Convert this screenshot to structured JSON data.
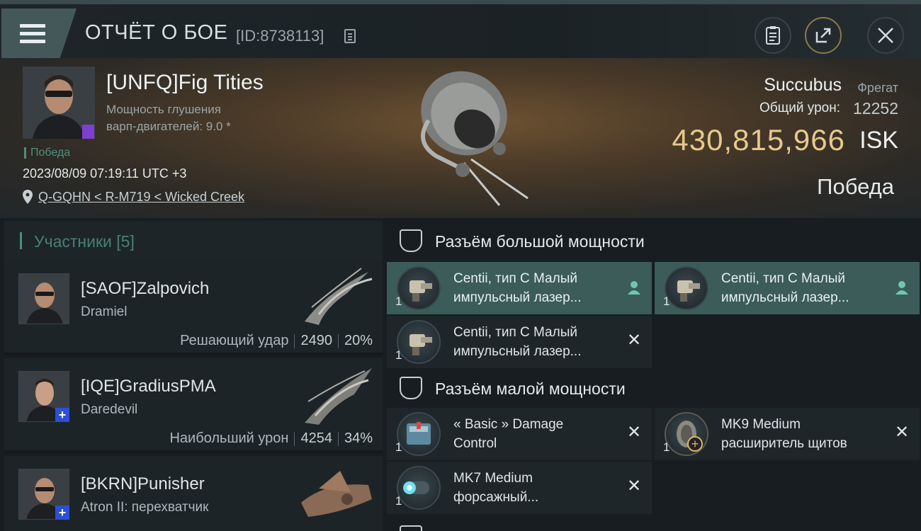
{
  "header": {
    "title": "ОТЧЁТ О БОЕ",
    "report_id": "[ID:8738113]",
    "icons": {
      "menu": "hamburger-icon",
      "copy": "copy-icon",
      "clipboard": "clipboard-icon",
      "share": "share-icon",
      "close": "close-icon"
    }
  },
  "victim": {
    "pilot": "[UNFQ]Fig Tities",
    "stat_line1": "Мощность глушения",
    "stat_line2": "варп-двигателей: 9.0 *",
    "result_tag": "Победа",
    "datetime": "2023/08/09 07:19:11 UTC +3",
    "location": "Q-GQHN < R-M719 < Wicked Creek",
    "ship_name": "Succubus",
    "ship_class": "Фрегат",
    "damage_label": "Общий урон:",
    "damage_value": "12252",
    "isk_value": "430,815,966",
    "isk_unit": "ISK",
    "result_big": "Победа"
  },
  "participants": {
    "heading": "Участники [5]",
    "items": [
      {
        "name": "[SAOF]Zalpovich",
        "ship": "Dramiel",
        "role": "Решающий удар",
        "damage": "2490",
        "percent": "20%"
      },
      {
        "name": "[IQE]GradiusPMA",
        "ship": "Daredevil",
        "role": "Наибольший урон",
        "damage": "4254",
        "percent": "34%"
      },
      {
        "name": "[BKRN]Punisher",
        "ship": "Atron II: перехватчик"
      }
    ]
  },
  "fitting": {
    "high_slots": {
      "heading": "Разъём большой мощности",
      "modules": [
        {
          "line1": "Centii, тип C Малый",
          "line2": "импульсный лазер...",
          "qty": "1"
        },
        {
          "line1": "Centii, тип C Малый",
          "line2": "импульсный лазер...",
          "qty": "1"
        },
        {
          "line1": "Centii, тип C Малый",
          "line2": "импульсный лазер...",
          "qty": "1"
        }
      ]
    },
    "low_slots": {
      "heading": "Разъём малой мощности",
      "modules": [
        {
          "line1": "« Basic » Damage",
          "line2": "Control",
          "qty": "1"
        },
        {
          "line1": "MK9 Medium",
          "line2": "расширитель щитов",
          "qty": "1"
        },
        {
          "line1": "MK7 Medium",
          "line2": "форсажный...",
          "qty": "1"
        }
      ]
    }
  },
  "colors": {
    "accent_gold": "#e7c98c",
    "accent_green": "#4e8f79",
    "highlight_row": "#3b5c59",
    "badge_blue": "#2b4fd6"
  }
}
